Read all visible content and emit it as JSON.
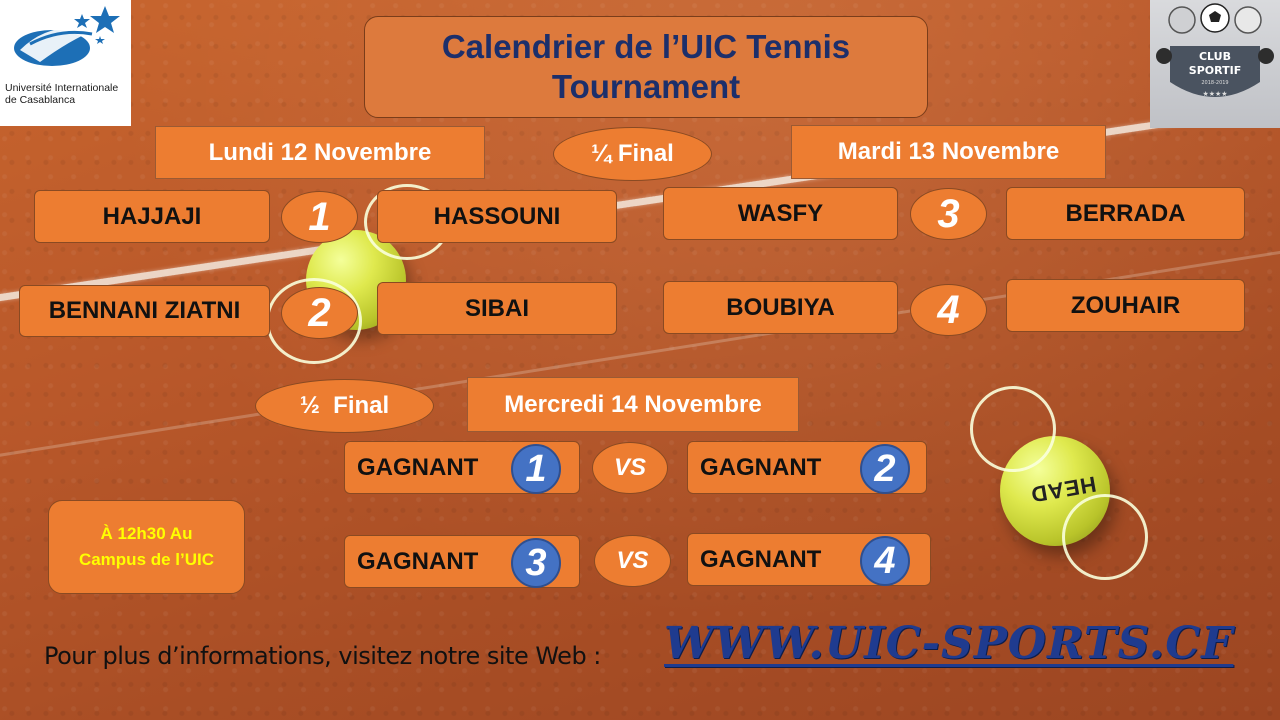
{
  "title": "Calendrier de l’UIC Tennis Tournament",
  "left_logo": {
    "text_line1": "Université Internationale",
    "text_line2": "de Casablanca"
  },
  "right_logo": {
    "line1": "CLUB",
    "line2": "SPORTIF",
    "sub": "2018-2019",
    "stars": "★★★★"
  },
  "quarter": {
    "label": "¼ Final",
    "day1": "Lundi 12 Novembre",
    "day2": "Mardi 13 Novembre",
    "matches": [
      {
        "number": "1",
        "p1": "HAJJAJI",
        "p2": "HASSOUNI"
      },
      {
        "number": "2",
        "p1": "BENNANI ZIATNI",
        "p2": "SIBAI"
      },
      {
        "number": "3",
        "p1": "WASFY",
        "p2": "BERRADA"
      },
      {
        "number": "4",
        "p1": "BOUBIYA",
        "p2": "ZOUHAIR"
      }
    ]
  },
  "semi": {
    "label": "½  Final",
    "day": "Mercredi 14 Novembre",
    "winner_label": "GAGNANT",
    "vs": "VS",
    "match1": {
      "a": "1",
      "b": "2"
    },
    "match2": {
      "a": "3",
      "b": "4"
    }
  },
  "info": {
    "line1": "À 12h30 Au",
    "line2": "Campus de l’UIC"
  },
  "footer": {
    "text": "Pour plus d’informations, visitez notre site Web :",
    "link": "WWW.UIC-SPORTS.CF"
  },
  "ball_brand": "HEAD",
  "colors": {
    "box_orange": "#ed7d31",
    "title_blue": "#1c2f6b",
    "number_blue": "#4472c4",
    "info_yellow": "#ffff00",
    "link_blue": "#1f3b8f"
  }
}
